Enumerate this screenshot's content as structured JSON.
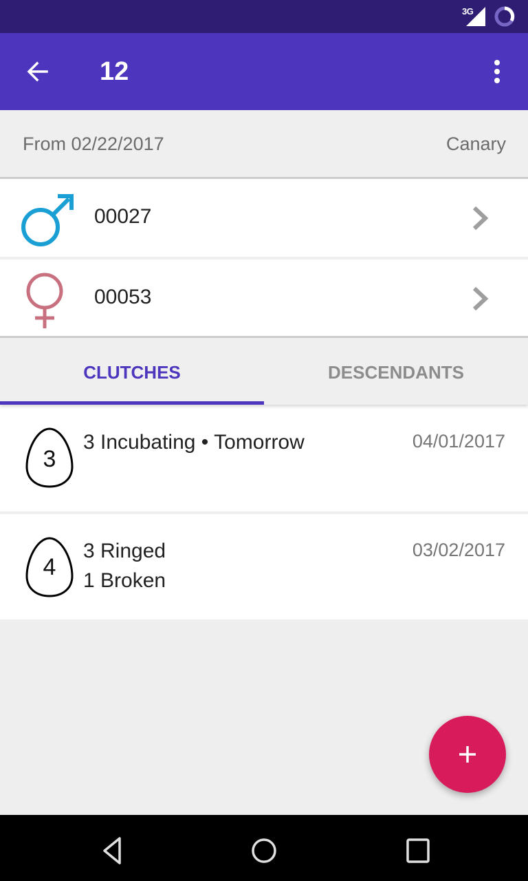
{
  "status_bar": {
    "network": "3G",
    "icons": [
      "signal-icon",
      "battery-icon"
    ]
  },
  "app_bar": {
    "title": "12",
    "back_icon": "arrow-left-icon",
    "menu_icon": "more-vert-icon"
  },
  "info": {
    "from": "From 02/22/2017",
    "species": "Canary"
  },
  "parents": [
    {
      "sex": "male",
      "ring": "00027",
      "color": "#1a9fd4"
    },
    {
      "sex": "female",
      "ring": "00053",
      "color": "#c8707f"
    }
  ],
  "tabs": [
    {
      "label": "CLUTCHES",
      "active": true
    },
    {
      "label": "DESCENDANTS",
      "active": false
    }
  ],
  "clutches": [
    {
      "egg_count": "3",
      "lines": [
        "3 Incubating • Tomorrow"
      ],
      "date": "04/01/2017"
    },
    {
      "egg_count": "4",
      "lines": [
        "3 Ringed",
        "1 Broken"
      ],
      "date": "03/02/2017"
    }
  ],
  "fab": {
    "icon": "plus-icon",
    "color": "#d81b5a"
  },
  "colors": {
    "primary": "#4e35be",
    "primary_dark": "#2e1d73",
    "accent": "#d81b5a"
  },
  "nav_bar": {
    "buttons": [
      "back-icon",
      "home-icon",
      "recents-icon"
    ]
  }
}
